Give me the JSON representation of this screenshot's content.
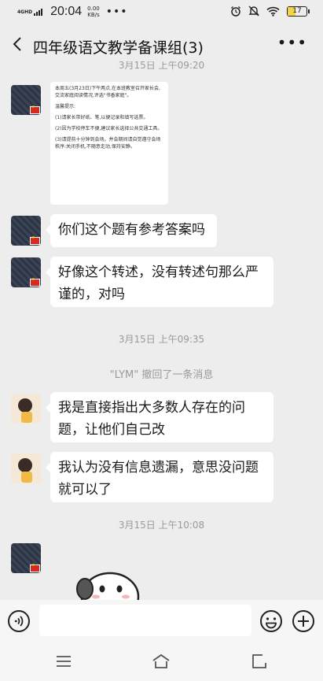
{
  "status_bar": {
    "network": "4GHD",
    "time": "20:04",
    "speed_value": "0.00",
    "speed_unit": "KB/s",
    "more": "•••",
    "battery": "17"
  },
  "header": {
    "title": "四年级语文教学备课组(3)",
    "more": "•••"
  },
  "chat": {
    "top_time": "3月15日 上午09:20",
    "doc_image": {
      "lines": [
        "本周五(3月23日)下午两点,在本班教室召开家长会,交流家庭阅读情况,评选\"书香家庭\"。",
        "温馨提示:",
        "(1)请家长带好纸、笔,以便记录和填写选票。",
        "(2)因为学校停车不便,建议家长选择公共交通工具。",
        "(3)请提前十分钟到会场。并会期间请自觉遵守会场秩序:关闭手机,不随意走动,保持安静。"
      ]
    },
    "messages": [
      {
        "text": "你们这个题有参考答案吗"
      },
      {
        "text": "好像这个转述，没有转述句那么严谨的，对吗"
      },
      {
        "text": "我是直接指出大多数人存在的问题，让他们自己改"
      },
      {
        "text": "我认为没有信息遗漏，意思没问题就可以了"
      }
    ],
    "time_2": "3月15日 上午09:35",
    "recall_notice": "\"LYM\" 撤回了一条消息",
    "time_3": "3月15日 上午10:08"
  },
  "input_bar": {
    "placeholder": ""
  },
  "icons": {
    "back": "back-arrow-icon",
    "voice": "voice-icon",
    "emoji": "emoji-icon",
    "plus": "plus-icon",
    "menu": "menu-icon",
    "home": "home-icon",
    "return": "return-icon"
  }
}
